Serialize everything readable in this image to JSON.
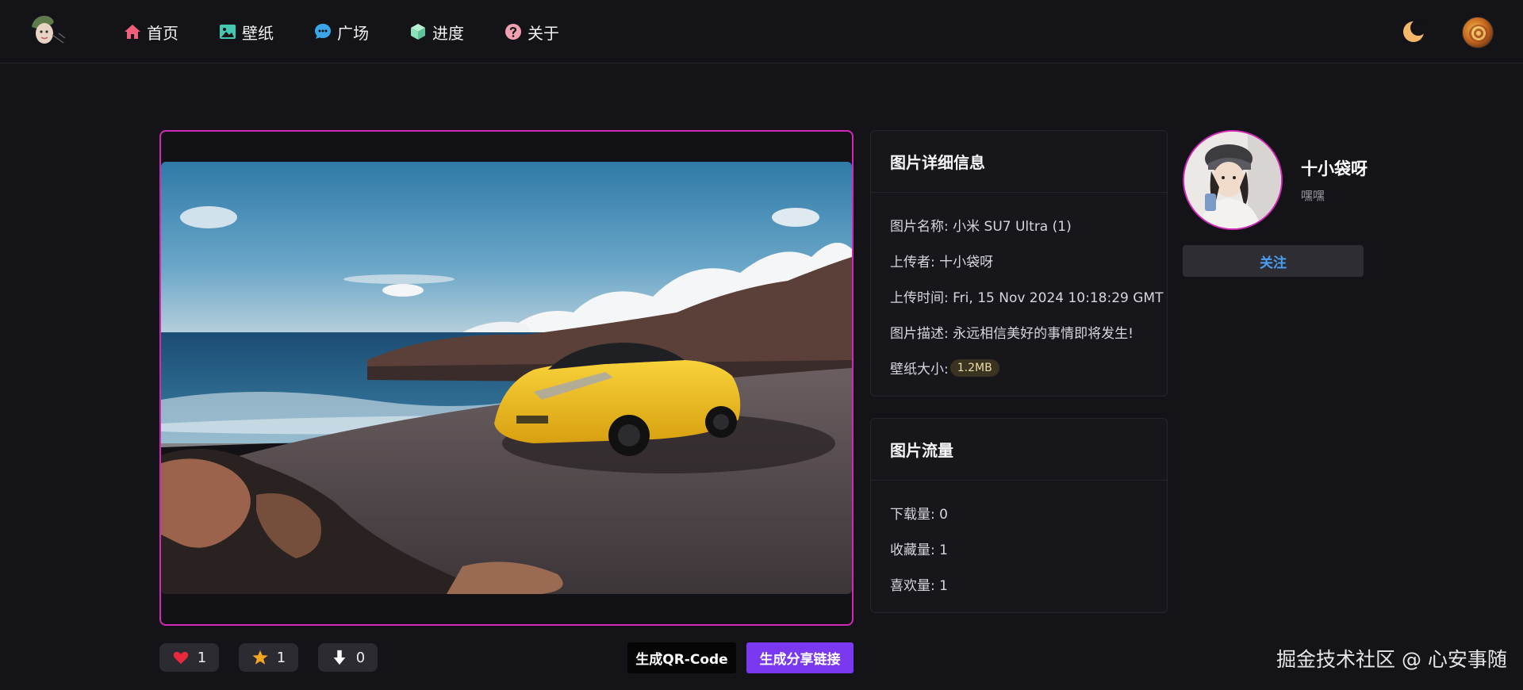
{
  "nav": {
    "items": [
      {
        "label": "首页",
        "icon": "home-icon",
        "color": "#f0607a"
      },
      {
        "label": "壁纸",
        "icon": "image-icon",
        "color": "#45c8b2"
      },
      {
        "label": "广场",
        "icon": "chat-icon",
        "color": "#3aa6e8"
      },
      {
        "label": "进度",
        "icon": "cube-icon",
        "color": "#8ee0b8"
      },
      {
        "label": "关于",
        "icon": "question-icon",
        "color": "#f0a0b0"
      }
    ]
  },
  "header": {
    "theme_icon": "moon-icon",
    "theme_color": "#f5b86a"
  },
  "actions": {
    "like_count": "1",
    "favorite_count": "1",
    "download_count": "0",
    "qr_label": "生成QR-Code",
    "share_label": "生成分享链接"
  },
  "details": {
    "title": "图片详细信息",
    "name_line": "图片名称: 小米 SU7 Ultra (1)",
    "uploader_line": "上传者: 十小袋呀",
    "time_line": "上传时间: Fri, 15 Nov 2024 10:18:29 GMT",
    "desc_line": "图片描述: 永远相信美好的事情即将发生!",
    "size_label": "壁纸大小:",
    "size_value": "1.2MB"
  },
  "traffic": {
    "title": "图片流量",
    "downloads_line": "下载量: 0",
    "favorites_line": "收藏量:  1",
    "likes_line": "喜欢量:  1"
  },
  "uploader": {
    "name": "十小袋呀",
    "bio": "嘿嘿",
    "follow_label": "关注"
  },
  "watermark": "掘金技术社区 @ 心安事随",
  "colors": {
    "accent_frame": "#d128b6",
    "share_button": "#7a38f0",
    "follow_text": "#4a9ff5",
    "heart": "#e8283c",
    "star": "#f5a623"
  }
}
